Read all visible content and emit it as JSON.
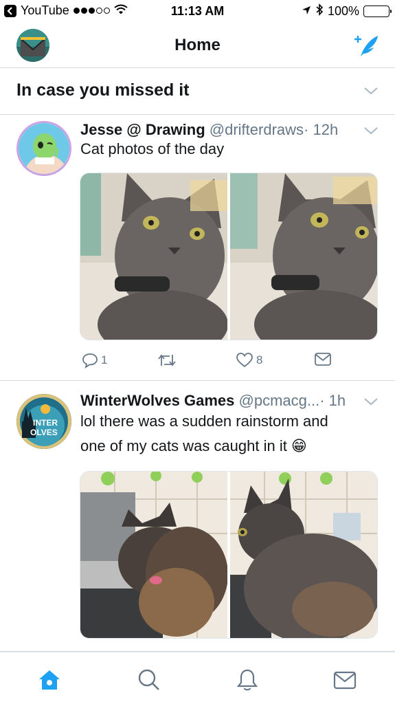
{
  "status_bar": {
    "back_app": "YouTube",
    "time": "11:13 AM",
    "battery": "100%"
  },
  "header": {
    "title": "Home"
  },
  "section": {
    "title": "In case you missed it"
  },
  "tweets": [
    {
      "name": "Jesse @ Drawing",
      "handle": "@drifterdraws",
      "time": "· 12h",
      "text": "Cat photos of the day",
      "replies": "1",
      "likes": "8"
    },
    {
      "name": "WinterWolves Games",
      "handle": "@pcmacg...",
      "time": "· 1h",
      "text_line1": "lol there was a sudden rainstorm and",
      "text_line2": "one of my cats was caught in it 😁",
      "avatar_text1": "INTER",
      "avatar_text2": "OLVES"
    }
  ],
  "colors": {
    "accent": "#1da1f2",
    "secondary_text": "#657786",
    "divider": "#d6d9db"
  }
}
